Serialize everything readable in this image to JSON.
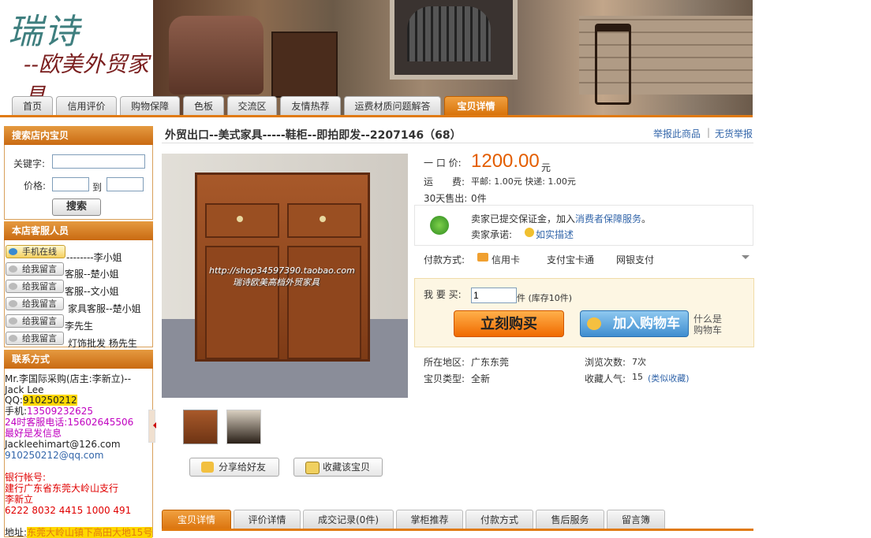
{
  "logo": {
    "main": "瑞诗",
    "sub": "--欧美外贸家具"
  },
  "nav": {
    "tabs": [
      "首页",
      "信用评价",
      "购物保障",
      "色板",
      "交流区",
      "友情热荐",
      "运费材质问题解答",
      "宝贝详情"
    ],
    "active_index": 7
  },
  "sidebar": {
    "search_title": "搜索店内宝贝",
    "keyword_label": "关键字:",
    "price_label": "价格:",
    "to_label": "到",
    "search_button": "搜索",
    "cs_title": "本店客服人员",
    "cs_items": [
      {
        "status": "手机在线",
        "name": "--------李小姐",
        "online": true
      },
      {
        "status": "给我留言",
        "name": "客服--楚小姐",
        "online": false
      },
      {
        "status": "给我留言",
        "name": "客服--文小姐",
        "online": false
      },
      {
        "status": "给我留言",
        "name": "家具客服--楚小姐",
        "online": false
      },
      {
        "status": "给我留言",
        "name": "李先生",
        "online": false
      },
      {
        "status": "给我留言",
        "name": "灯饰批发  杨先生",
        "online": false
      }
    ],
    "contact_title": "联系方式",
    "contact": {
      "shop": "Mr.李国际采购(店主:李新立)--Jack Lee",
      "qq_label": "QQ:",
      "qq": "910250212",
      "phone_label": "手机:",
      "phone": "13509232625",
      "hotline": "24时客服电话:15602645506",
      "tip": "最好是发信息",
      "email1": "Jackleehimart@126.com",
      "email2": "910250212@qq.com",
      "bank_title": "银行帐号:",
      "bank_name": "建行广东省东莞大岭山支行",
      "bank_owner": "李新立",
      "bank_no": "6222 8032 4415 1000 491",
      "address_label": "地址:",
      "address": "东莞大岭山镇下高田大地15号"
    }
  },
  "product": {
    "title": "外贸出口--美式家具-----鞋柜--即拍即发--2207146（68）",
    "report": "举报此商品",
    "report_sep": "|",
    "no_goods": "无货举报",
    "price_label": "一 口 价:",
    "price": "1200.00",
    "currency": "元",
    "shipping_label": "运　　费:",
    "shipping": "平邮: 1.00元 快递: 1.00元",
    "sold_label": "30天售出:",
    "sold": "0件",
    "guarantee_text": "卖家已提交保证金，加入",
    "guarantee_link": "消费者保障服务",
    "guarantee_end": "。",
    "promise_label": "卖家承诺:",
    "promise_link": "如实描述",
    "payment_label": "付款方式:",
    "payments": [
      "信用卡",
      "支付宝卡通",
      "网银支付"
    ],
    "buy_label": "我 要 买:",
    "quantity": "1",
    "stock": "件 (库存10件)",
    "buy_button": "立刻购买",
    "cart_button": "加入购物车",
    "cart_help": "什么是购物车",
    "location_label": "所在地区:",
    "location": "广东东莞",
    "type_label": "宝贝类型:",
    "type": "全新",
    "views_label": "浏览次数:",
    "views": "7次",
    "fav_label": "收藏人气:",
    "fav": "15",
    "fav_link": "(类似收藏)",
    "watermark1": "http://shop34597390.taobao.com",
    "watermark2": "瑞诗欧美高档外贸家具",
    "share_button": "分享给好友",
    "collect_button": "收藏该宝贝"
  },
  "detail_tabs": [
    "宝贝详情",
    "评价详情",
    "成交记录(0件)",
    "掌柜推荐",
    "付款方式",
    "售后服务",
    "留言簿"
  ],
  "colors": {
    "accent": "#e07a10",
    "price": "#e35d00",
    "link": "#3366aa"
  }
}
